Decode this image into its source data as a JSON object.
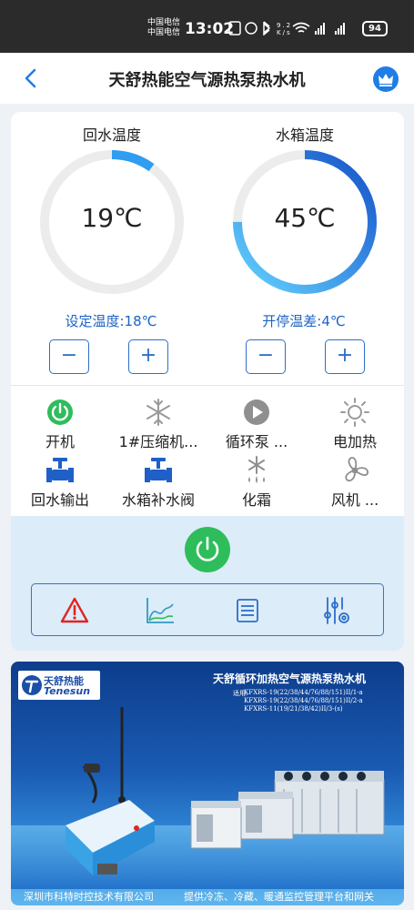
{
  "status_bar": {
    "carrier_line1": "中国电信",
    "carrier_line2": "中国电信",
    "time": "13:02",
    "icons": [
      "nfc-icon",
      "alarm-icon",
      "bluetooth-icon",
      "speed-icon",
      "wifi-icon",
      "signal-icon",
      "signal-icon"
    ],
    "speed": "9.2 K/s",
    "battery": "94"
  },
  "header": {
    "title": "天舒热能空气源热泵热水机"
  },
  "gauges": [
    {
      "title": "回水温度",
      "value": "19℃",
      "level": 0.1,
      "color": "#2f9df0"
    },
    {
      "title": "水箱温度",
      "value": "45℃",
      "level": 0.75,
      "color": "#1f6ed8"
    }
  ],
  "settings": {
    "set_temp": "设定温度:18℃",
    "diff_temp": "开停温差:4℃",
    "minus": "−",
    "plus": "+"
  },
  "status_items": [
    {
      "label": "开机",
      "icon": "power-on-icon",
      "active": true
    },
    {
      "label": "1#压缩机...",
      "icon": "snowflake-icon",
      "active": false
    },
    {
      "label": "循环泵 ...",
      "icon": "play-icon",
      "active": false
    },
    {
      "label": "电加热",
      "icon": "sun-icon",
      "active": false
    },
    {
      "label": "回水输出",
      "icon": "valve-icon",
      "active": true
    },
    {
      "label": "水箱补水阀",
      "icon": "valve-icon",
      "active": true
    },
    {
      "label": "化霜",
      "icon": "defrost-icon",
      "active": false
    },
    {
      "label": "风机 ...",
      "icon": "fan-icon",
      "active": false
    }
  ],
  "toolbar": [
    "alarm-warning-icon",
    "curve-chart-icon",
    "list-icon",
    "settings-sliders-icon"
  ],
  "banner": {
    "logo_cn": "天舒热能",
    "logo_en": "Tenesun",
    "title": "天舒循环加热空气源热泵热水机",
    "apply": "适用:",
    "models": [
      "KFXRS-19(22/38/44/76/88/151)II/1-a",
      "KFXRS-19(22/38/44/76/88/151)II/2-a",
      "KFXRS-11(19/21/38/42)II/3-(s)"
    ],
    "footer_left": "深圳市科特时控技术有限公司",
    "footer_right": "提供冷冻、冷藏、暖通监控管理平台和网关"
  },
  "colors": {
    "accent": "#1d63c5",
    "power_green": "#2ebd5b",
    "alarm_red": "#e02424"
  }
}
